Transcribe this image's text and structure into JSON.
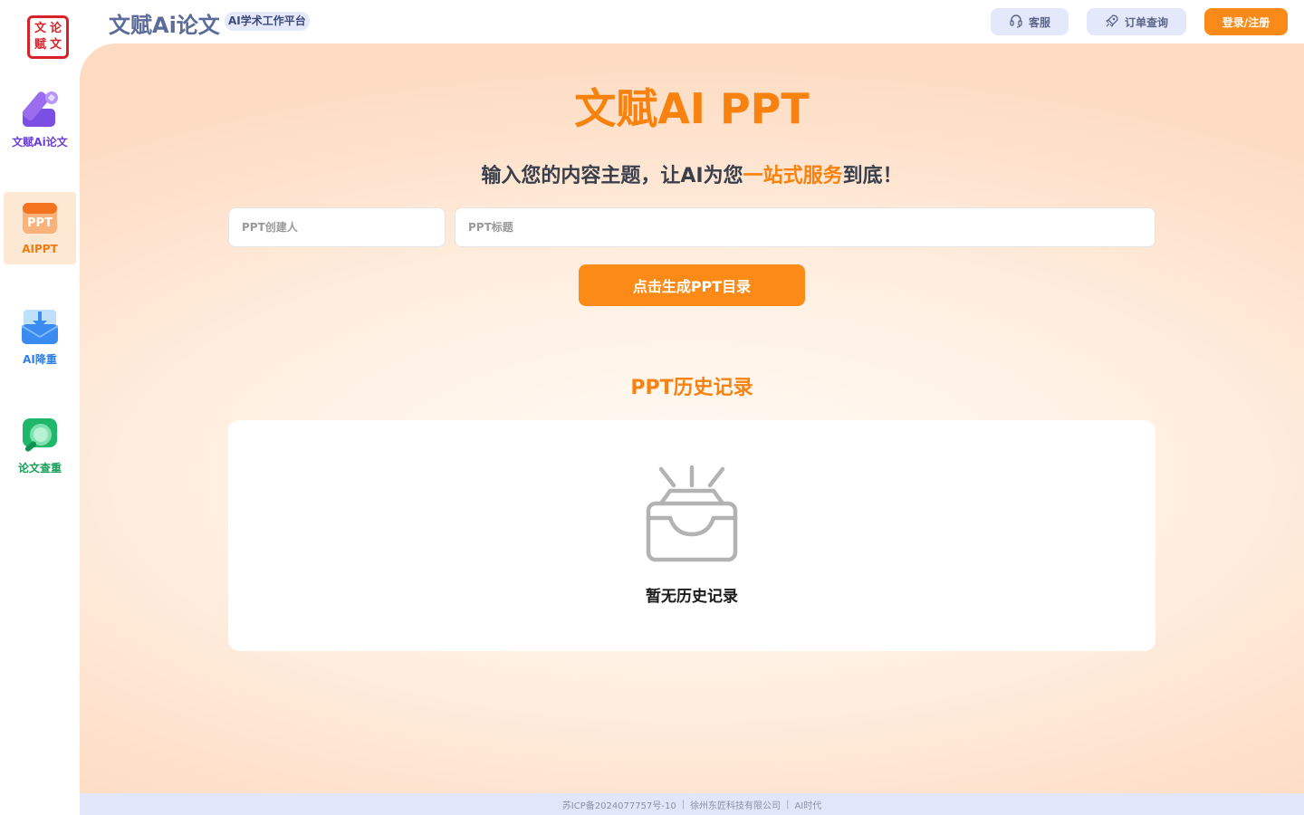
{
  "brand": {
    "seal_chars": [
      "文",
      "论",
      "赋",
      "文"
    ],
    "title": "文赋Ai论文",
    "badge": "AI学术工作平台"
  },
  "header": {
    "service_label": "客服",
    "orders_label": "订单查询",
    "login_label": "登录/注册"
  },
  "sidebar": {
    "items": [
      {
        "label": "文赋Ai论文",
        "icon": "pencil-icon",
        "color": "#6a3fd8"
      },
      {
        "label": "AIPPT",
        "icon": "ppt-icon",
        "color": "#f27a10",
        "active": true
      },
      {
        "label": "AI降重",
        "icon": "download-tray-icon",
        "color": "#2f7fe6"
      },
      {
        "label": "论文查重",
        "icon": "search-chat-icon",
        "color": "#16a05a"
      }
    ]
  },
  "main": {
    "hero_title": "文赋AI PPT",
    "subtitle_pre": "输入您的内容主题，让AI为您",
    "subtitle_highlight": "一站式服务",
    "subtitle_post": "到底！",
    "creator_placeholder": "PPT创建人",
    "creator_value": "",
    "title_placeholder": "PPT标题",
    "title_value": "",
    "generate_label": "点击生成PPT目录",
    "history_title": "PPT历史记录",
    "empty_text": "暂无历史记录"
  },
  "footer": {
    "icp": "苏ICP备2024077757号-10",
    "company": "徐州东匠科技有限公司",
    "era": "AI时代"
  },
  "colors": {
    "accent": "#f7820f",
    "header_button": "#e3e8fb",
    "footer_bg": "#e1e6fa"
  }
}
